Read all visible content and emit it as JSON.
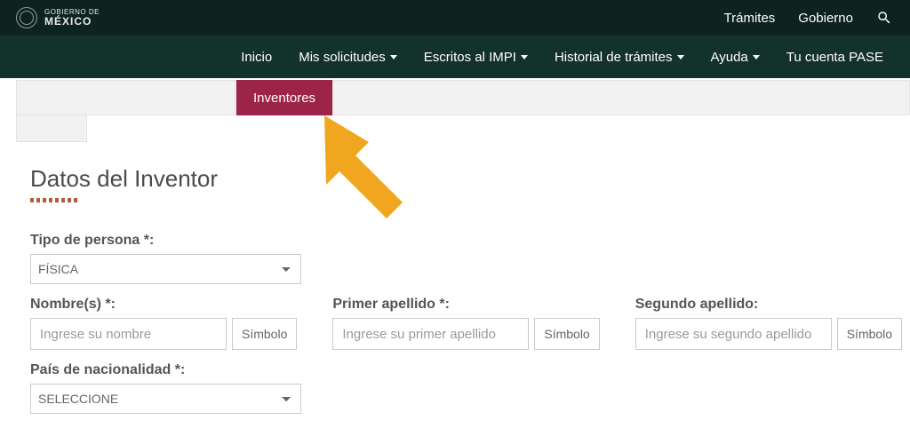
{
  "topbar": {
    "gov_label_small": "GOBIERNO DE",
    "gov_label_big": "MÉXICO",
    "links": {
      "tramites": "Trámites",
      "gobierno": "Gobierno"
    }
  },
  "nav": {
    "inicio": "Inicio",
    "solicitudes": "Mis solicitudes",
    "escritos": "Escritos al IMPI",
    "historial": "Historial de trámites",
    "ayuda": "Ayuda",
    "cuenta": "Tu cuenta PASE"
  },
  "tabs": {
    "active": "Inventores"
  },
  "section": {
    "title": "Datos del Inventor"
  },
  "form": {
    "tipo_persona": {
      "label": "Tipo de persona *:",
      "value": "FÍSICA"
    },
    "nombre": {
      "label": "Nombre(s) *:",
      "placeholder": "Ingrese su nombre",
      "simbolo": "Símbolo"
    },
    "primer_apellido": {
      "label": "Primer apellido *:",
      "placeholder": "Ingrese su primer apellido",
      "simbolo": "Símbolo"
    },
    "segundo_apellido": {
      "label": "Segundo apellido:",
      "placeholder": "Ingrese su segundo apellido",
      "simbolo": "Símbolo"
    },
    "pais": {
      "label": "País de nacionalidad *:",
      "value": "SELECCIONE"
    }
  }
}
